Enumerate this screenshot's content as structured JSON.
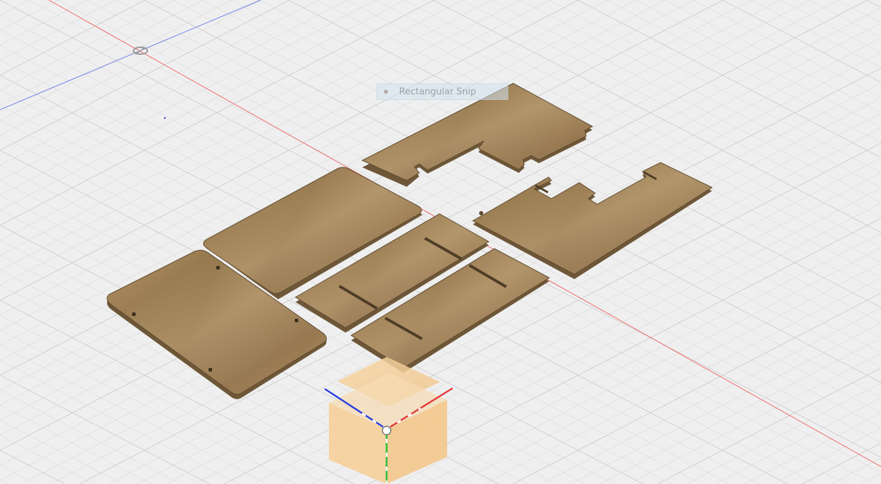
{
  "snip_tooltip": {
    "label": "Rectangular Snip"
  },
  "colors": {
    "background": "#efefef",
    "grid_minor": "#dcdcdc",
    "grid_major": "#c9c9c9",
    "x_axis": "#e8514f",
    "y_axis": "#38b04a",
    "z_axis": "#4b5fe0",
    "wood": "#a88a5c",
    "wood_edge": "#6e5738",
    "viewcube": "#f4c98b"
  },
  "icons": {
    "origin": "origin-marker-icon",
    "viewcube": "viewcube-icon",
    "snip": "snip-icon"
  }
}
